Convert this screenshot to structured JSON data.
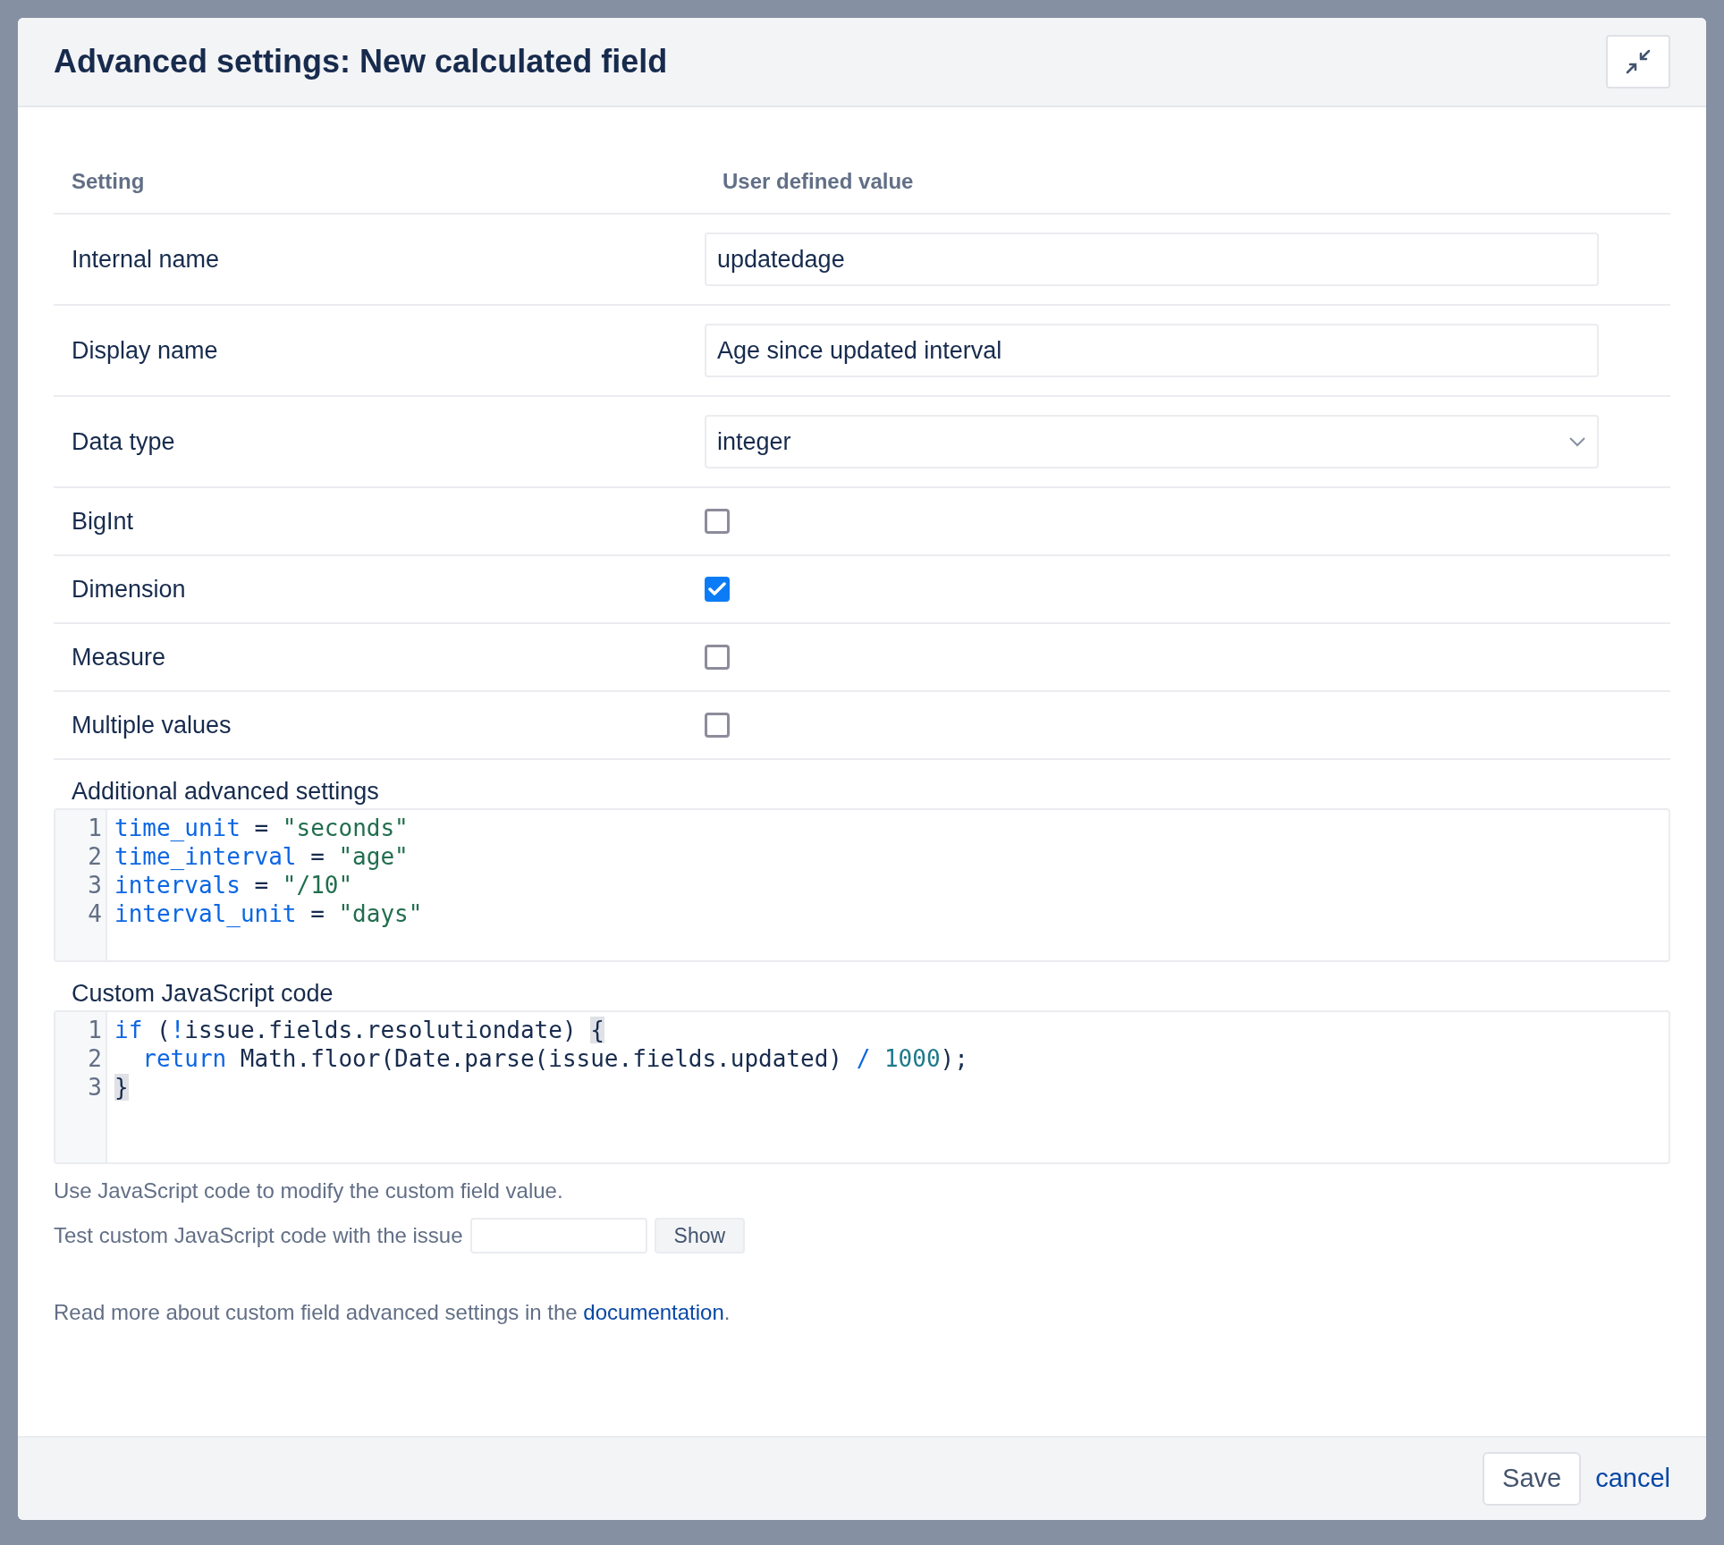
{
  "dialog": {
    "title": "Advanced settings: New calculated field"
  },
  "table": {
    "columns": [
      "Setting",
      "User defined value"
    ],
    "rows": [
      {
        "kind": "text",
        "label": "Internal name",
        "value": "updatedage"
      },
      {
        "kind": "text",
        "label": "Display name",
        "value": "Age since updated interval"
      },
      {
        "kind": "select",
        "label": "Data type",
        "value": "integer"
      },
      {
        "kind": "checkbox",
        "label": "BigInt",
        "checked": false
      },
      {
        "kind": "checkbox",
        "label": "Dimension",
        "checked": true
      },
      {
        "kind": "checkbox",
        "label": "Measure",
        "checked": false
      },
      {
        "kind": "checkbox",
        "label": "Multiple values",
        "checked": false
      }
    ]
  },
  "editors": [
    {
      "label": "Additional advanced settings",
      "lines": [
        {
          "number": "1",
          "tokens": [
            {
              "kind": "var",
              "text": "time_unit"
            },
            {
              "kind": "plain",
              "text": " = "
            },
            {
              "kind": "str",
              "text": "\"seconds\""
            }
          ]
        },
        {
          "number": "2",
          "tokens": [
            {
              "kind": "var",
              "text": "time_interval"
            },
            {
              "kind": "plain",
              "text": " = "
            },
            {
              "kind": "str",
              "text": "\"age\""
            }
          ]
        },
        {
          "number": "3",
          "tokens": [
            {
              "kind": "var",
              "text": "intervals"
            },
            {
              "kind": "plain",
              "text": " = "
            },
            {
              "kind": "str",
              "text": "\"/10\""
            }
          ]
        },
        {
          "number": "4",
          "tokens": [
            {
              "kind": "var",
              "text": "interval_unit"
            },
            {
              "kind": "plain",
              "text": " = "
            },
            {
              "kind": "str",
              "text": "\"days\""
            }
          ]
        }
      ]
    },
    {
      "label": "Custom JavaScript code",
      "lines": [
        {
          "number": "1",
          "tokens": [
            {
              "kind": "kw",
              "text": "if"
            },
            {
              "kind": "plain",
              "text": " ("
            },
            {
              "kind": "kw",
              "text": "!"
            },
            {
              "kind": "plain",
              "text": "issue.fields.resolutiondate) "
            },
            {
              "kind": "match",
              "text": "{"
            }
          ]
        },
        {
          "number": "2",
          "indented": true,
          "tokens": [
            {
              "kind": "kw",
              "text": "return"
            },
            {
              "kind": "plain",
              "text": " Math.floor(Date.parse(issue.fields.updated) "
            },
            {
              "kind": "kw",
              "text": "/"
            },
            {
              "kind": "num",
              "text": " 1000"
            },
            {
              "kind": "plain",
              "text": ");"
            }
          ]
        },
        {
          "number": "3",
          "tokens": [
            {
              "kind": "match",
              "text": "}"
            }
          ]
        }
      ]
    }
  ],
  "hint": "Use JavaScript code to modify the custom field value.",
  "test": {
    "label": "Test custom JavaScript code with the issue",
    "button": "Show"
  },
  "docs": {
    "text": "Read more about custom field advanced settings in the ",
    "link": "documentation",
    "after": "."
  },
  "footer": {
    "save": "Save",
    "cancel": "cancel"
  }
}
